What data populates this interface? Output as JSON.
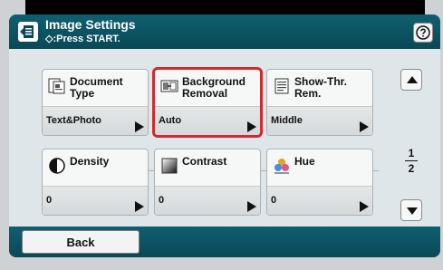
{
  "header": {
    "title": "Image Settings",
    "subtitle": "◇:Press START."
  },
  "tiles": [
    {
      "label": "Document\nType",
      "value": "Text&Photo",
      "icon": "document-type-icon",
      "selected": false
    },
    {
      "label": "Background\nRemoval",
      "value": "Auto",
      "icon": "background-removal-icon",
      "selected": true
    },
    {
      "label": "Show-Thr.\nRem.",
      "value": "Middle",
      "icon": "show-through-removal-icon",
      "selected": false
    },
    {
      "label": "Density",
      "value": "0",
      "icon": "density-icon",
      "selected": false
    },
    {
      "label": "Contrast",
      "value": "0",
      "icon": "contrast-icon",
      "selected": false
    },
    {
      "label": "Hue",
      "value": "0",
      "icon": "hue-icon",
      "selected": false
    }
  ],
  "pagination": {
    "current": "1",
    "total": "2"
  },
  "footer": {
    "back_label": "Back"
  },
  "colors": {
    "header_bg": "#0f5f70",
    "selection": "#d22a2a",
    "tile_bg": "#f6f7f7"
  }
}
